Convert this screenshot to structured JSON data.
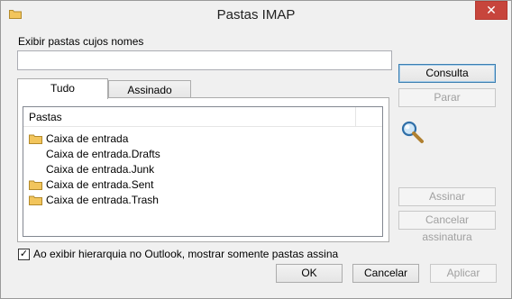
{
  "window": {
    "title": "Pastas IMAP",
    "close_glyph": "✕"
  },
  "filter": {
    "label": "Exibir pastas cujos nomes",
    "value": "",
    "placeholder": ""
  },
  "tabs": [
    {
      "label": "Tudo",
      "active": true
    },
    {
      "label": "Assinado",
      "active": false
    }
  ],
  "list": {
    "header": "Pastas",
    "rows": [
      {
        "label": "Caixa de entrada",
        "icon": "folder-icon"
      },
      {
        "label": "Caixa de entrada.Drafts",
        "icon": ""
      },
      {
        "label": "Caixa de entrada.Junk",
        "icon": ""
      },
      {
        "label": "Caixa de entrada.Sent",
        "icon": "folder-icon"
      },
      {
        "label": "Caixa de entrada.Trash",
        "icon": "folder-icon"
      }
    ]
  },
  "side_buttons": {
    "consulta": "Consulta",
    "parar": "Parar",
    "assinar": "Assinar",
    "cancelar_assinatura": "Cancelar assinatura"
  },
  "checkbox": {
    "checked": true,
    "label": "Ao exibir hierarquia no Outlook, mostrar somente pastas assina"
  },
  "bottom_buttons": {
    "ok": "OK",
    "cancelar": "Cancelar",
    "aplicar": "Aplicar"
  },
  "colors": {
    "folder": "#f2c55c",
    "close": "#c7453c",
    "accent": "#3c7fb1"
  }
}
